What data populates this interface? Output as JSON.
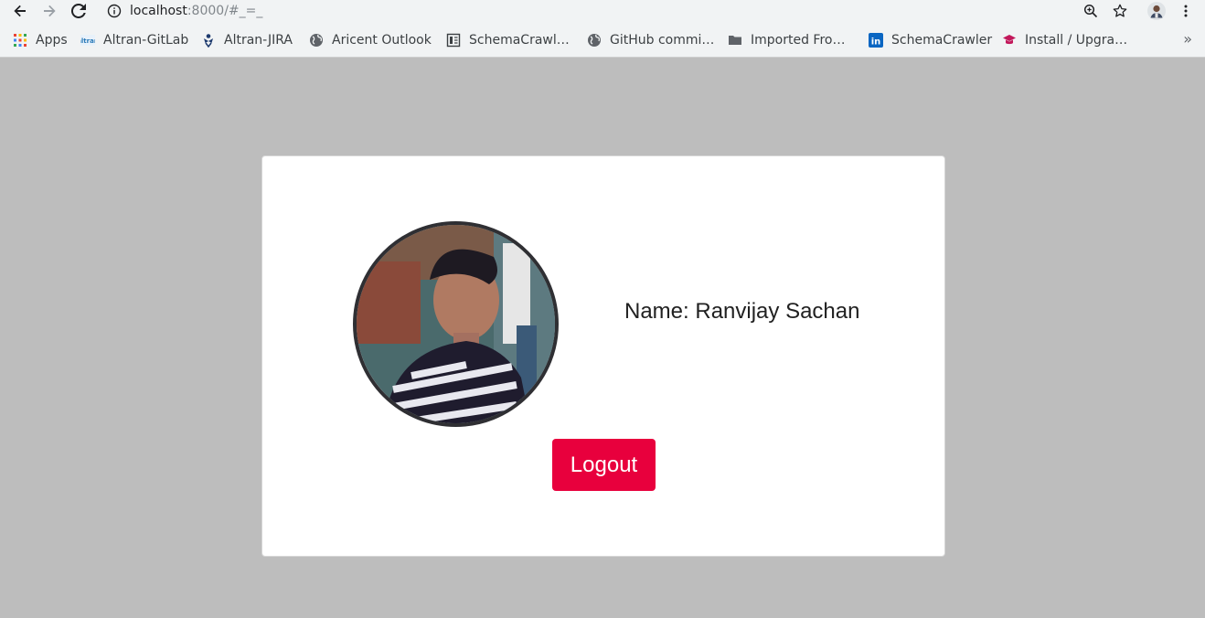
{
  "browser": {
    "url_host": "localhost",
    "url_rest": ":8000/#_=_"
  },
  "bookmarks": [
    {
      "label": "Apps",
      "icon": "apps-grid-icon"
    },
    {
      "label": "Altran-GitLab",
      "icon": "gitlab-icon"
    },
    {
      "label": "Altran-JIRA",
      "icon": "jira-icon"
    },
    {
      "label": "Aricent Outlook",
      "icon": "globe-icon"
    },
    {
      "label": "SchemaCrawl…",
      "icon": "document-icon"
    },
    {
      "label": "GitHub commi…",
      "icon": "globe-icon"
    },
    {
      "label": "Imported Fro…",
      "icon": "folder-icon"
    },
    {
      "label": "SchemaCrawler",
      "icon": "linkedin-icon"
    },
    {
      "label": "Install / Upgra…",
      "icon": "graduation-cap-icon"
    }
  ],
  "profile": {
    "name_text": "Name: Ranvijay Sachan",
    "logout_label": "Logout"
  },
  "colors": {
    "page_background": "#bdbdbd",
    "card_background": "#ffffff",
    "logout_button": "#e8003d"
  }
}
